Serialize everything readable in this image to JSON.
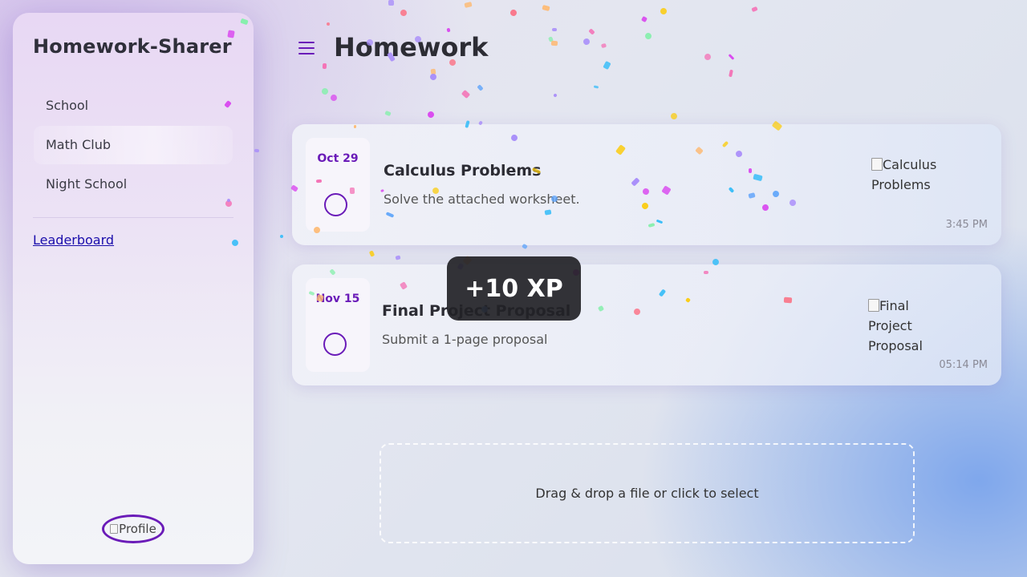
{
  "sidebar": {
    "brand": "Homework-Sharer",
    "items": [
      {
        "label": "School"
      },
      {
        "label": "Math Club"
      },
      {
        "label": "Night School"
      }
    ],
    "leaderboard_link": "Leaderboard",
    "profile_alt": "Profile"
  },
  "header": {
    "title": "Homework",
    "menu_icon": "hamburger-menu-icon"
  },
  "tasks": [
    {
      "date": "Oct 29",
      "title": "Calculus Problems",
      "description": "Solve the attached worksheet.",
      "image_alt": "Calculus Problems",
      "time": "3:45 PM"
    },
    {
      "date": "Nov 15",
      "title": "Final Project Proposal",
      "description": "Submit a 1-page proposal",
      "image_alt": "Final Project Proposal",
      "time": "05:14 PM"
    }
  ],
  "dropzone": {
    "label": "Drag & drop a file or click to select"
  },
  "toast": {
    "text": "+10 XP"
  },
  "colors": {
    "accent": "#6a1bb8",
    "link": "#1a0dab",
    "toast_bg": "#222226",
    "confetti": [
      "#f472b6",
      "#60a5fa",
      "#a78bfa",
      "#facc15",
      "#86efac",
      "#fb7185",
      "#fdba74",
      "#38bdf8",
      "#d946ef"
    ]
  }
}
